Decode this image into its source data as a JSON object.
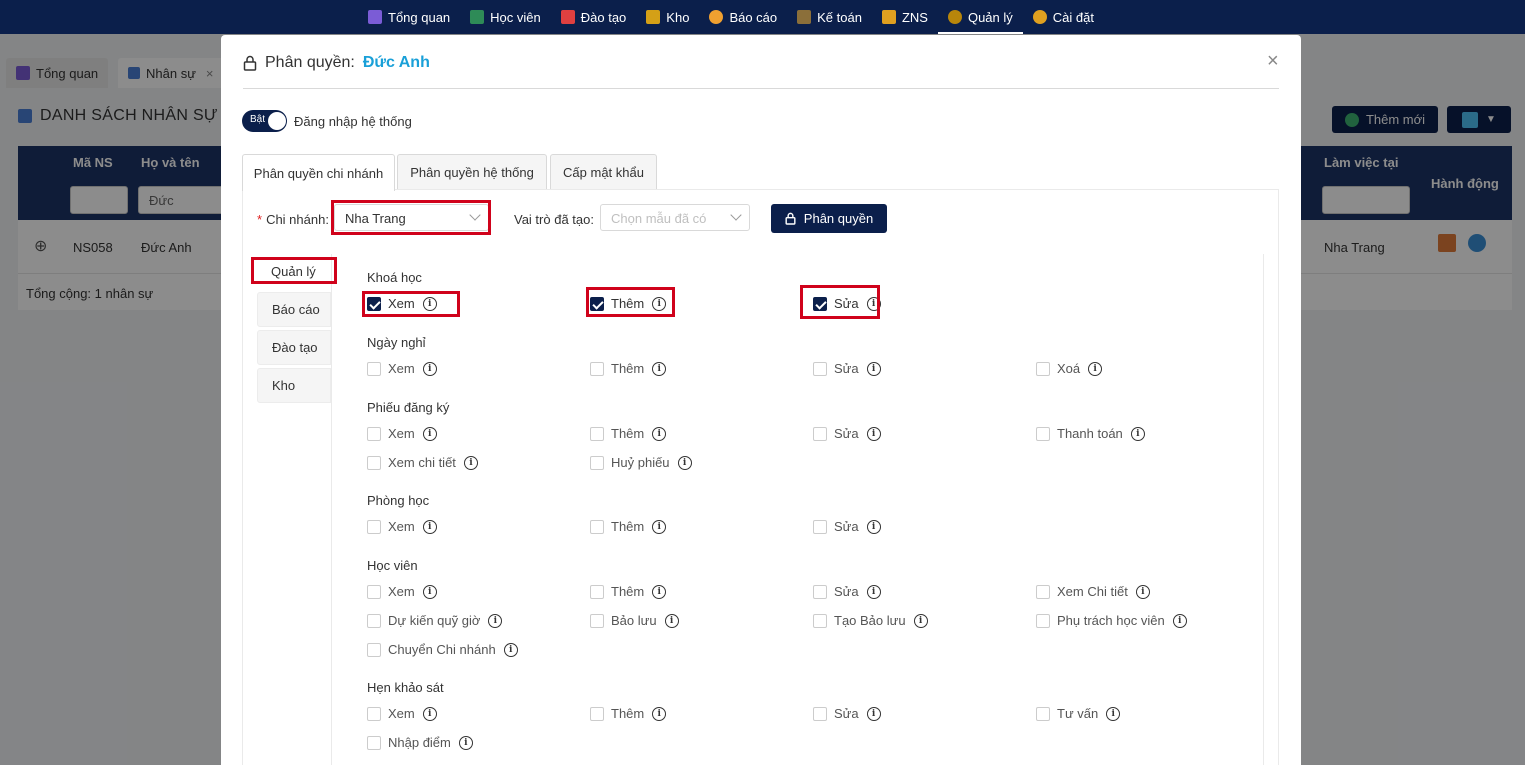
{
  "topnav": {
    "items": [
      {
        "label": "Tổng quan",
        "icon": "dashboard-icon",
        "color": "#7b5cd6"
      },
      {
        "label": "Học viên",
        "icon": "student-icon",
        "color": "#2e8b57"
      },
      {
        "label": "Đào tạo",
        "icon": "training-icon",
        "color": "#e04040"
      },
      {
        "label": "Kho",
        "icon": "box-icon",
        "color": "#d4a017"
      },
      {
        "label": "Báo cáo",
        "icon": "report-icon",
        "color": "#f0a030"
      },
      {
        "label": "Kế toán",
        "icon": "accounting-icon",
        "color": "#8b6f3a"
      },
      {
        "label": "ZNS",
        "icon": "zns-icon",
        "color": "#e0a020"
      },
      {
        "label": "Quản lý",
        "icon": "management-icon",
        "color": "#b8860b"
      },
      {
        "label": "Cài đặt",
        "icon": "settings-icon",
        "color": "#e0a020"
      }
    ]
  },
  "page_tabs": [
    {
      "label": "Tổng quan"
    },
    {
      "label": "Nhân sự"
    }
  ],
  "page": {
    "title": "DANH SÁCH NHÂN SỰ",
    "add_button": "Thêm mới",
    "table": {
      "headers": {
        "code": "Mã NS",
        "name": "Họ và tên",
        "workplace": "Làm việc tại",
        "actions": "Hành động"
      },
      "filter_name": "Đức",
      "rows": [
        {
          "code": "NS058",
          "name": "Đức Anh",
          "workplace": "Nha Trang"
        }
      ],
      "footer": "Tổng cộng: 1 nhân sự"
    }
  },
  "modal": {
    "title_prefix": "Phân quyền:",
    "title_name": "Đức Anh",
    "toggle": {
      "state_label": "Bật",
      "label": "Đăng nhập hệ thống"
    },
    "tabs": [
      "Phân quyền chi nhánh",
      "Phân quyền hệ thống",
      "Cấp mật khẩu"
    ],
    "branch": {
      "label": "Chi nhánh:",
      "value": "Nha Trang"
    },
    "role": {
      "label": "Vai trò đã tạo:",
      "placeholder": "Chọn mẫu đã có"
    },
    "permission_button": "Phân quyền",
    "side_tabs": [
      "Quản lý",
      "Báo cáo",
      "Đào tạo",
      "Kho"
    ],
    "groups": [
      {
        "title": "Khoá học",
        "perms": [
          {
            "label": "Xem",
            "checked": true
          },
          {
            "label": "Thêm",
            "checked": true
          },
          {
            "label": "Sửa",
            "checked": true
          }
        ]
      },
      {
        "title": "Ngày nghỉ",
        "perms": [
          {
            "label": "Xem",
            "checked": false
          },
          {
            "label": "Thêm",
            "checked": false
          },
          {
            "label": "Sửa",
            "checked": false
          },
          {
            "label": "Xoá",
            "checked": false
          }
        ]
      },
      {
        "title": "Phiếu đăng ký",
        "perms": [
          {
            "label": "Xem",
            "checked": false
          },
          {
            "label": "Thêm",
            "checked": false
          },
          {
            "label": "Sửa",
            "checked": false
          },
          {
            "label": "Thanh toán",
            "checked": false
          },
          {
            "label": "Xem chi tiết",
            "checked": false
          },
          {
            "label": "Huỷ phiếu",
            "checked": false
          }
        ]
      },
      {
        "title": "Phòng học",
        "perms": [
          {
            "label": "Xem",
            "checked": false
          },
          {
            "label": "Thêm",
            "checked": false
          },
          {
            "label": "Sửa",
            "checked": false
          }
        ]
      },
      {
        "title": "Học viên",
        "perms": [
          {
            "label": "Xem",
            "checked": false
          },
          {
            "label": "Thêm",
            "checked": false
          },
          {
            "label": "Sửa",
            "checked": false
          },
          {
            "label": "Xem Chi tiết",
            "checked": false
          },
          {
            "label": "Dự kiến quỹ giờ",
            "checked": false
          },
          {
            "label": "Bảo lưu",
            "checked": false
          },
          {
            "label": "Tạo Bảo lưu",
            "checked": false
          },
          {
            "label": "Phụ trách học viên",
            "checked": false
          },
          {
            "label": "Chuyển Chi nhánh",
            "checked": false
          }
        ]
      },
      {
        "title": "Hẹn khảo sát",
        "perms": [
          {
            "label": "Xem",
            "checked": false
          },
          {
            "label": "Thêm",
            "checked": false
          },
          {
            "label": "Sửa",
            "checked": false
          },
          {
            "label": "Tư vấn",
            "checked": false
          },
          {
            "label": "Nhập điểm",
            "checked": false
          }
        ]
      }
    ]
  },
  "colors": {
    "navy": "#0b1f4b",
    "accent": "#1aa0d8",
    "highlight": "#d0021b"
  }
}
